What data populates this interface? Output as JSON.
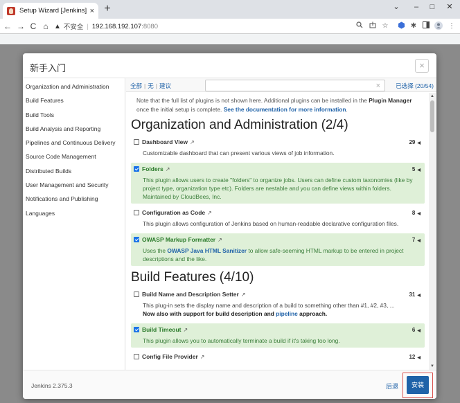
{
  "browser": {
    "tab_title": "Setup Wizard [Jenkins]",
    "tab_close": "×",
    "new_tab": "+",
    "win_minimize": "–",
    "win_maximize": "□",
    "win_close": "✕",
    "win_dropdown": "⌄",
    "back": "←",
    "forward": "→",
    "reload": "C",
    "home": "⌂",
    "security_label": "不安全",
    "url_host": "192.168.192.107",
    "url_port": ":8080",
    "icons": [
      "zoom-icon",
      "share-icon",
      "star-icon",
      "extension-icon",
      "puzzle-icon",
      "sidepanel-icon",
      "profile-icon",
      "menu-icon"
    ]
  },
  "modal": {
    "title": "新手入门",
    "close": "×",
    "sidebar": [
      "Organization and Administration",
      "Build Features",
      "Build Tools",
      "Build Analysis and Reporting",
      "Pipelines and Continuous Delivery",
      "Source Code Management",
      "Distributed Builds",
      "User Management and Security",
      "Notifications and Publishing",
      "Languages"
    ],
    "selector": {
      "all": "全部",
      "none": "无",
      "suggested": "建议",
      "separator": "|",
      "search_value": "",
      "clear": "×",
      "selected_count": "已选择 (20/54)"
    },
    "notice": {
      "text1": "Note that the full list of plugins is not shown here. Additional plugins can be installed in the ",
      "bold": "Plugin Manager",
      "text2": " once the initial setup is complete. ",
      "link": "See the documentation for more information",
      "text3": "."
    },
    "categories": [
      {
        "title": "Organization and Administration (2/4)",
        "plugins": [
          {
            "name": "Dashboard View",
            "ext": "↗",
            "deps": "29",
            "selected": false,
            "desc": "Customizable dashboard that can present various views of job information."
          },
          {
            "name": "Folders",
            "ext": "↗",
            "deps": "5",
            "selected": true,
            "desc": "This plugin allows users to create \"folders\" to organize jobs. Users can define custom taxonomies (like by project type, organization type etc). Folders are nestable and you can define views within folders. Maintained by CloudBees, Inc."
          },
          {
            "name": "Configuration as Code",
            "ext": "↗",
            "deps": "8",
            "selected": false,
            "desc": "This plugin allows configuration of Jenkins based on human-readable declarative configuration files."
          },
          {
            "name": "OWASP Markup Formatter",
            "ext": "↗",
            "deps": "7",
            "selected": true,
            "desc_pre": "Uses the ",
            "desc_link": "OWASP Java HTML Sanitizer",
            "desc_post": " to allow safe-seeming HTML markup to be entered in project descriptions and the like."
          }
        ]
      },
      {
        "title": "Build Features (4/10)",
        "plugins": [
          {
            "name": "Build Name and Description Setter",
            "ext": "↗",
            "deps": "31",
            "selected": false,
            "desc": "This plug-in sets the display name and description of a build to something other than #1, #2, #3, ...",
            "desc_bold_pre": "Now also with support for build description and ",
            "desc_bold_link": "pipeline",
            "desc_bold_post": " approach."
          },
          {
            "name": "Build Timeout",
            "ext": "↗",
            "deps": "6",
            "selected": true,
            "desc": "This plugin allows you to automatically terminate a build if it's taking too long."
          },
          {
            "name": "Config File Provider",
            "ext": "↗",
            "deps": "12",
            "selected": false,
            "desc": ""
          }
        ]
      }
    ],
    "dep_arrow": "◀",
    "scroll_up": "▲",
    "scroll_down": "▼",
    "footer": {
      "version": "Jenkins 2.375.3",
      "back": "后退",
      "install": "安装"
    }
  }
}
